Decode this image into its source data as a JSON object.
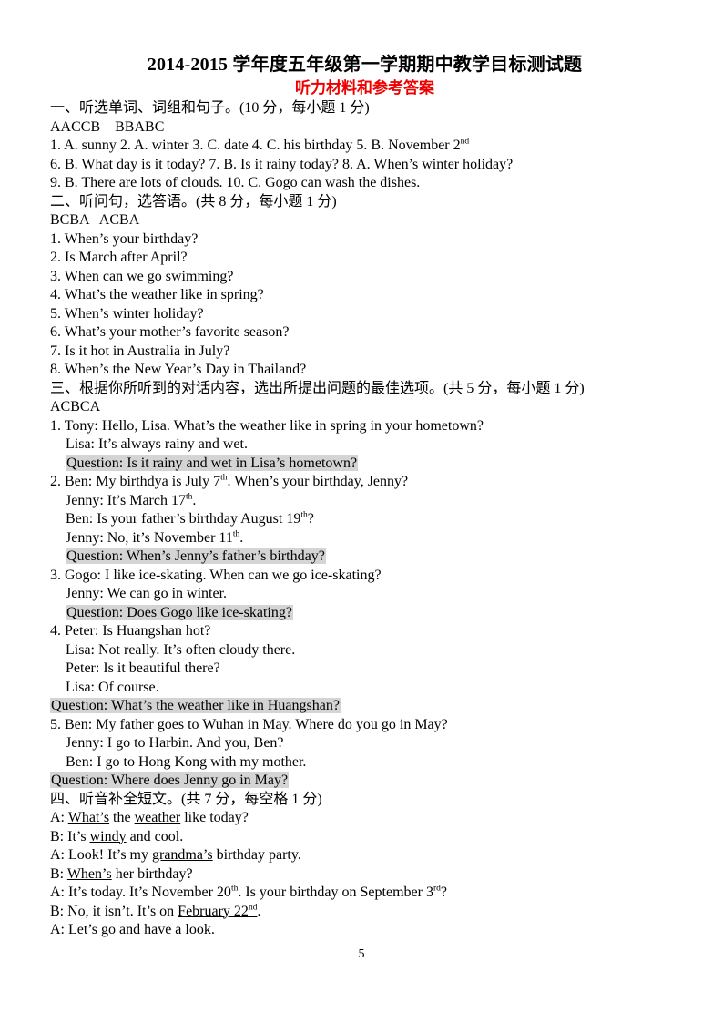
{
  "document": {
    "title": "2014-2015 学年度五年级第一学期期中教学目标测试题",
    "subtitle": "听力材料和参考答案",
    "page_number": "5"
  },
  "section_one": {
    "heading": "一、听选单词、词组和句子。(10 分，每小题 1 分)",
    "answer_key": "AACCB    BBABC",
    "items_line1_pre": "1. A. sunny   2. A. winter       3. C. date     4. C. his birthday     5. B. November 2",
    "items_line1_sup": "nd",
    "items_line2": "6. B. What day is it today?      7. B. Is it rainy today?      8. A. When’s winter holiday?",
    "items_line3": "9. B. There are lots of clouds.     10. C. Gogo can wash the dishes."
  },
  "section_two": {
    "heading": "二、听问句，选答语。(共 8 分，每小题 1 分)",
    "answer_key": "BCBA   ACBA",
    "questions": [
      "1. When’s your birthday?",
      "2. Is March after April?",
      "3. When can we go swimming?",
      "4. What’s the weather like in spring?",
      "5. When’s winter holiday?",
      "6. What’s your mother’s favorite season?",
      "7. Is it hot in Australia in July?",
      "8. When’s the New Year’s Day in Thailand?"
    ]
  },
  "section_three": {
    "heading": "三、根据你所听到的对话内容，选出所提出问题的最佳选项。(共 5 分，每小题 1 分)",
    "answer_key": "ACBCA",
    "dialogue1": {
      "lines": [
        "1. Tony: Hello, Lisa. What’s the weather like in spring in your hometown?",
        "Lisa: It’s always rainy and wet."
      ],
      "question": "Question: Is it rainy and wet in Lisa’s hometown?"
    },
    "dialogue2": {
      "line1_a": "2. Ben: My birthdya is July 7",
      "line1_sup": "th",
      "line1_b": ". When’s your birthday, Jenny?",
      "line2_a": "Jenny: It’s March 17",
      "line2_sup": "th",
      "line2_b": ".",
      "line3_a": "Ben: Is your father’s birthday August 19",
      "line3_sup": "th",
      "line3_b": "?",
      "line4_a": "Jenny: No, it’s November 11",
      "line4_sup": "th",
      "line4_b": ".",
      "question": "Question: When’s Jenny’s father’s birthday?"
    },
    "dialogue3": {
      "lines": [
        "3. Gogo: I like ice-skating. When can we go ice-skating?",
        "Jenny: We can go in winter."
      ],
      "question": "Question: Does Gogo like ice-skating?"
    },
    "dialogue4": {
      "lines": [
        "4. Peter: Is Huangshan hot?",
        "Lisa: Not really. It’s often cloudy there.",
        "Peter: Is it beautiful there?",
        "Lisa: Of course."
      ],
      "question": "Question: What’s the weather like in Huangshan?"
    },
    "dialogue5": {
      "lines": [
        "5. Ben: My father goes to Wuhan in May. Where do you go in May?",
        "Jenny: I go to Harbin. And you, Ben?",
        "Ben: I go to Hong Kong with my mother."
      ],
      "question": "Question: Where does Jenny go in May?"
    }
  },
  "section_four": {
    "heading": "四、听音补全短文。(共 7 分，每空格 1 分)",
    "line1_a": "A: ",
    "line1_u1": "What’s",
    "line1_b": " the ",
    "line1_u2": "weather",
    "line1_c": " like today?",
    "line2_a": "B: It’s ",
    "line2_u1": "windy",
    "line2_b": " and cool.",
    "line3_a": "A: Look! It’s my ",
    "line3_u1": "grandma’s",
    "line3_b": " birthday party.",
    "line4_a": "B: ",
    "line4_u1": "When’s",
    "line4_b": " her birthday?",
    "line5_a": "A: It’s today. It’s November 20",
    "line5_sup1": "th",
    "line5_b": ". Is your birthday on September 3",
    "line5_sup2": "rd",
    "line5_c": "?",
    "line6_a": "B: No, it isn’t. It’s on ",
    "line6_u1": "February 22",
    "line6_u1sup": "nd",
    "line6_b": ".",
    "line7": "A: Let’s go and have a look."
  },
  "colors": {
    "subtitle_red": "#ee0000",
    "highlight_gray": "#d4d4d4",
    "text": "#000000"
  }
}
